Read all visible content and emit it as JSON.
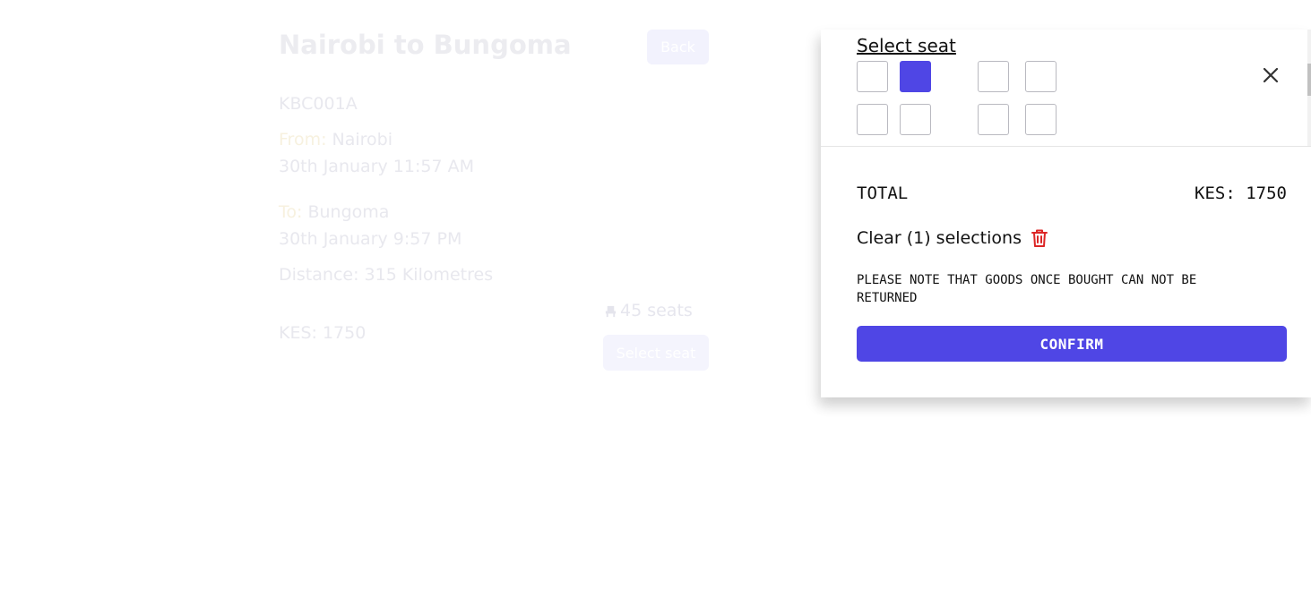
{
  "background": {
    "title": "Nairobi to Bungoma",
    "back_label": "Back",
    "bus_code": "KBC001A",
    "from_label": "From:",
    "from_value": "Nairobi",
    "departure": "30th January 11:57 AM",
    "to_label": "To:",
    "to_value": "Bungoma",
    "arrival": "30th January 9:57 PM",
    "distance": "Distance: 315 Kilometres",
    "seats_count": "45 seats",
    "price": "KES: 1750",
    "select_seat_label": "Select seat"
  },
  "drawer": {
    "heading": "Select seat",
    "seat_rows": [
      [
        false,
        true,
        false,
        false
      ],
      [
        false,
        false,
        false,
        false
      ]
    ],
    "total_label": "TOTAL",
    "total_value": "KES: 1750",
    "clear_label": "Clear (1) selections",
    "note": "PLEASE NOTE THAT GOODS ONCE BOUGHT CAN NOT BE RETURNED",
    "confirm_label": "CONFIRM"
  },
  "colors": {
    "accent": "#4f46e5",
    "danger": "#dc2626"
  },
  "icons": [
    "seat-icon",
    "close-icon",
    "trash-icon"
  ]
}
